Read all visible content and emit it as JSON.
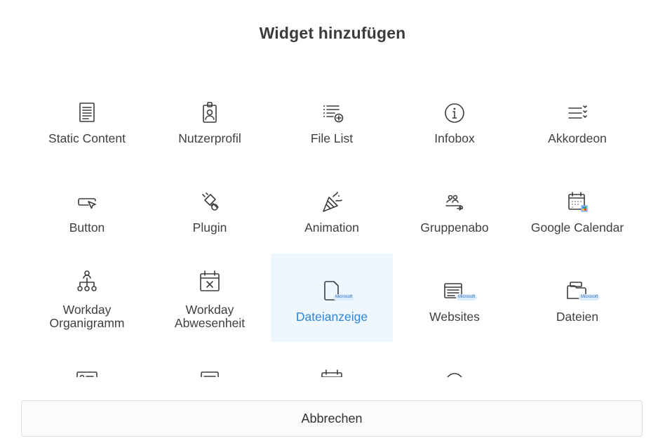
{
  "dialog": {
    "title": "Widget hinzufügen",
    "cancel_label": "Abbrechen"
  },
  "widgets": [
    {
      "label": "Static Content",
      "icon": "document-icon"
    },
    {
      "label": "Nutzerprofil",
      "icon": "id-badge-icon"
    },
    {
      "label": "File List",
      "icon": "list-add-icon"
    },
    {
      "label": "Infobox",
      "icon": "info-icon"
    },
    {
      "label": "Akkordeon",
      "icon": "accordion-icon"
    },
    {
      "label": "Button",
      "icon": "button-cursor-icon"
    },
    {
      "label": "Plugin",
      "icon": "plug-icon"
    },
    {
      "label": "Animation",
      "icon": "party-popper-icon"
    },
    {
      "label": "Gruppenabo",
      "icon": "group-subscription-icon"
    },
    {
      "label": "Google Calendar",
      "icon": "google-calendar-icon"
    },
    {
      "label_line1": "Workday",
      "label_line2": "Organigramm",
      "icon": "org-chart-icon"
    },
    {
      "label_line1": "Workday",
      "label_line2": "Abwesenheit",
      "icon": "calendar-x-icon"
    },
    {
      "label": "Dateianzeige",
      "icon": "file-icon",
      "badge": "Microsoft",
      "selected": true
    },
    {
      "label": "Websites",
      "icon": "website-icon",
      "badge": "Microsoft"
    },
    {
      "label": "Dateien",
      "icon": "folder-icon",
      "badge": "Microsoft"
    },
    {
      "icon": "contact-card-icon"
    },
    {
      "icon": "message-icon"
    },
    {
      "icon": "calendar-icon"
    },
    {
      "icon": "group-circle-icon"
    },
    {
      "icon": "more-icon"
    }
  ],
  "colors": {
    "accent": "#2f86d6",
    "selected_bg": "#eef6fe",
    "badge_bg": "#dcecfb"
  }
}
